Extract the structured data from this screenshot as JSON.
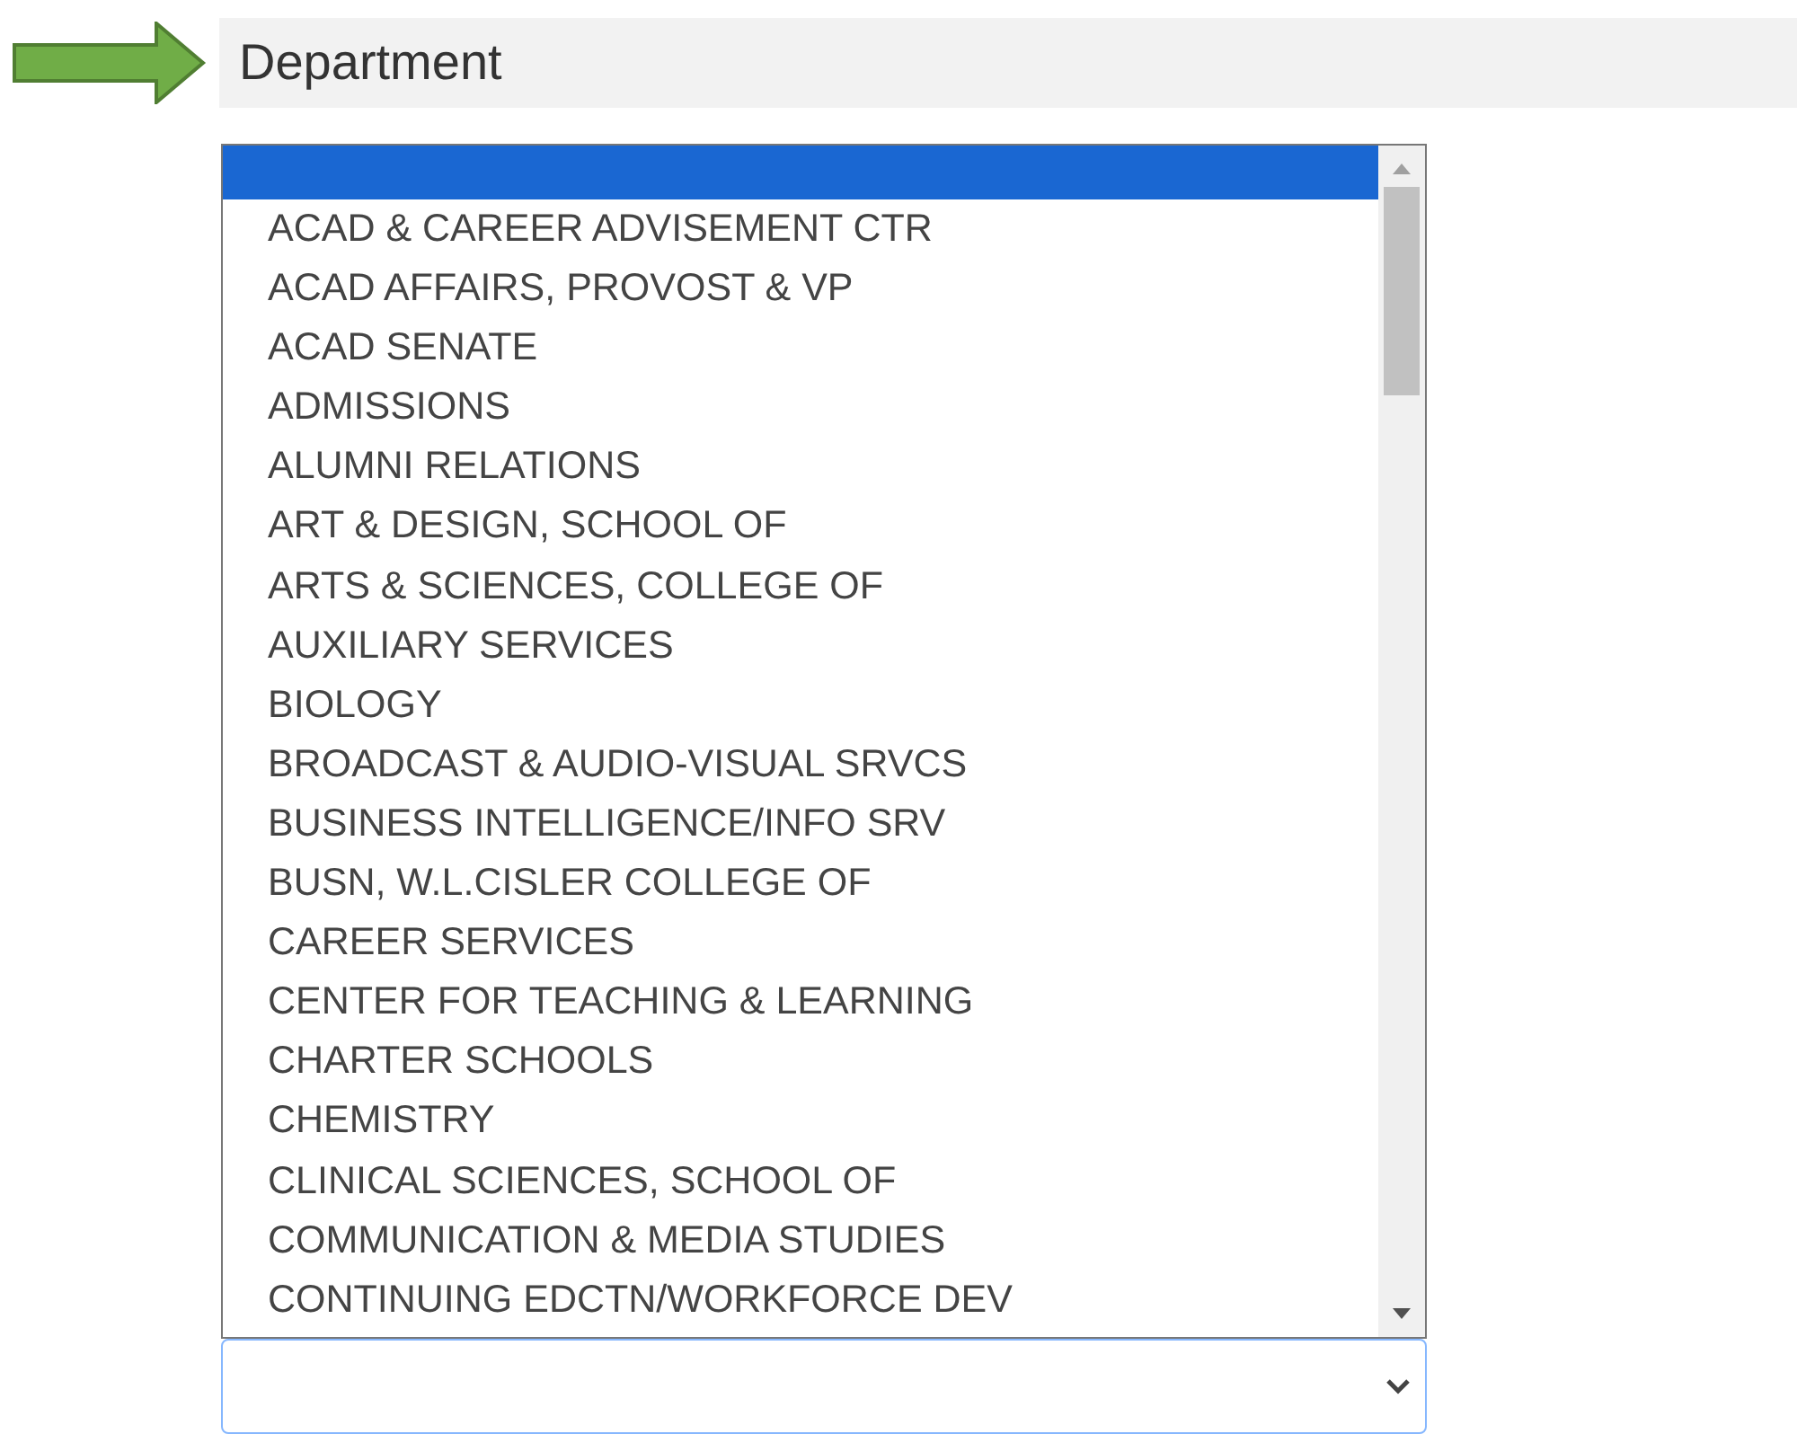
{
  "field": {
    "label": "Department"
  },
  "dropdown": {
    "blank_option": {
      "selected": true
    },
    "options": [
      {
        "label": "ACAD & CAREER ADVISEMENT CTR",
        "selected": false
      },
      {
        "label": "ACAD AFFAIRS, PROVOST & VP",
        "selected": false
      },
      {
        "label": "ACAD SENATE",
        "selected": false
      },
      {
        "label": "ADMISSIONS",
        "selected": false
      },
      {
        "label": "ALUMNI RELATIONS",
        "selected": false
      },
      {
        "label": "ART & DESIGN, SCHOOL OF",
        "selected": false
      },
      {
        "label": "ARTS & SCIENCES, COLLEGE OF",
        "selected": false
      },
      {
        "label": "AUXILIARY SERVICES",
        "selected": false
      },
      {
        "label": "BIOLOGY",
        "selected": false
      },
      {
        "label": "BROADCAST & AUDIO-VISUAL SRVCS",
        "selected": false
      },
      {
        "label": "BUSINESS INTELLIGENCE/INFO SRV",
        "selected": false
      },
      {
        "label": "BUSN, W.L.CISLER COLLEGE OF",
        "selected": false
      },
      {
        "label": "CAREER SERVICES",
        "selected": false
      },
      {
        "label": "CENTER FOR TEACHING & LEARNING",
        "selected": false
      },
      {
        "label": "CHARTER SCHOOLS",
        "selected": false
      },
      {
        "label": "CHEMISTRY",
        "selected": false
      },
      {
        "label": "CLINICAL SCIENCES, SCHOOL OF",
        "selected": false
      },
      {
        "label": "COMMUNICATION & MEDIA STUDIES",
        "selected": false
      },
      {
        "label": "CONTINUING EDCTN/WORKFORCE DEV",
        "selected": false
      }
    ]
  }
}
